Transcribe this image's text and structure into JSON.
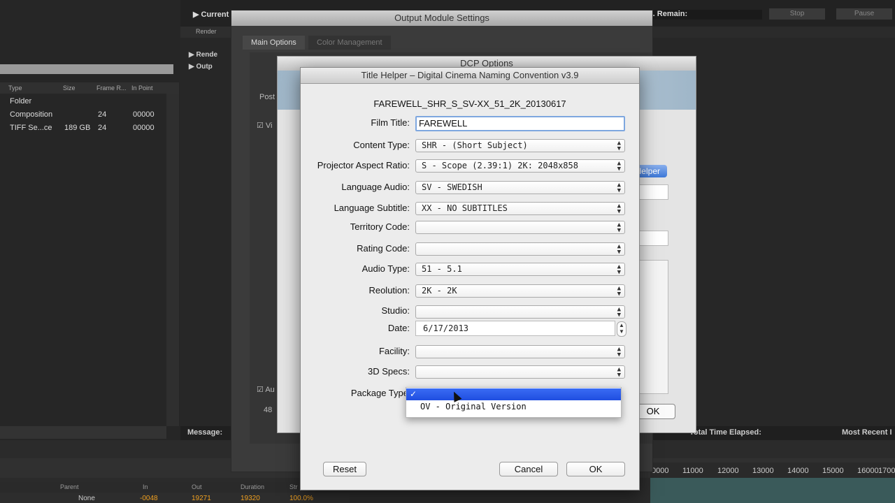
{
  "ae": {
    "left_columns": [
      "Type",
      "Size",
      "Frame R...",
      "In Point"
    ],
    "left_rows": [
      {
        "type": "Folder",
        "size": "",
        "fps": "",
        "in": ""
      },
      {
        "type": "Composition",
        "size": "",
        "fps": "24",
        "in": "00000"
      },
      {
        "type": "TIFF Se...ce",
        "size": "189 GB",
        "fps": "24",
        "in": "00000"
      }
    ],
    "current_label": "Current",
    "remain_label": "t. Remain:",
    "stop_label": "Stop",
    "pause_label": "Pause",
    "render_col": "Render",
    "tree": [
      "Rende",
      "Outp"
    ],
    "message_label": "Message:",
    "total_time_label": "Total Time Elapsed:",
    "most_recent_label": "Most Recent I",
    "timeline_cols": [
      "Parent",
      "In",
      "Out",
      "Duration",
      "Str"
    ],
    "timeline_row": {
      "parent": "None",
      "in": "-0048",
      "out": "19271",
      "duration": "19320",
      "str": "100.0%"
    },
    "ruler": [
      "0000",
      "11000",
      "12000",
      "13000",
      "14000",
      "15000",
      "16000",
      "17000"
    ]
  },
  "oms": {
    "title": "Output Module Settings",
    "tabs": [
      "Main Options",
      "Color Management"
    ],
    "post_label": "Post",
    "vid_label": "Vi",
    "au_label": "Au",
    "value_48": "48"
  },
  "dcp": {
    "title": "DCP Options",
    "helper_button": "Helper",
    "ok_label": "OK"
  },
  "title_helper": {
    "title": "Title Helper – Digital Cinema Naming Convention v3.9",
    "filename": "FAREWELL_SHR_S_SV-XX_51_2K_20130617",
    "film_title_label": "Film Title:",
    "film_title_value": "FAREWELL",
    "fields": [
      {
        "label": "Content Type:",
        "value": "SHR - (Short Subject)"
      },
      {
        "label": "Projector Aspect Ratio:",
        "value": "S - Scope (2.39:1) 2K: 2048x858"
      },
      {
        "label": "Language Audio:",
        "value": "SV  - SWEDISH"
      },
      {
        "label": "Language Subtitle:",
        "value": "XX  - NO SUBTITLES"
      },
      {
        "label": "Territory Code:",
        "value": ""
      },
      {
        "label": "Rating Code:",
        "value": ""
      },
      {
        "label": "Audio Type:",
        "value": "51 - 5.1"
      },
      {
        "label": "Reolution:",
        "value": "2K - 2K"
      },
      {
        "label": "Studio:",
        "value": ""
      }
    ],
    "date_label": "Date:",
    "date_value": "6/17/2013",
    "fields2": [
      {
        "label": "Facility:",
        "value": ""
      },
      {
        "label": "3D Specs:",
        "value": ""
      }
    ],
    "package_type_label": "Package Type",
    "dropdown_selected": "✓",
    "dropdown_option": "OV - Original Version",
    "reset_label": "Reset",
    "cancel_label": "Cancel",
    "ok_label": "OK"
  }
}
